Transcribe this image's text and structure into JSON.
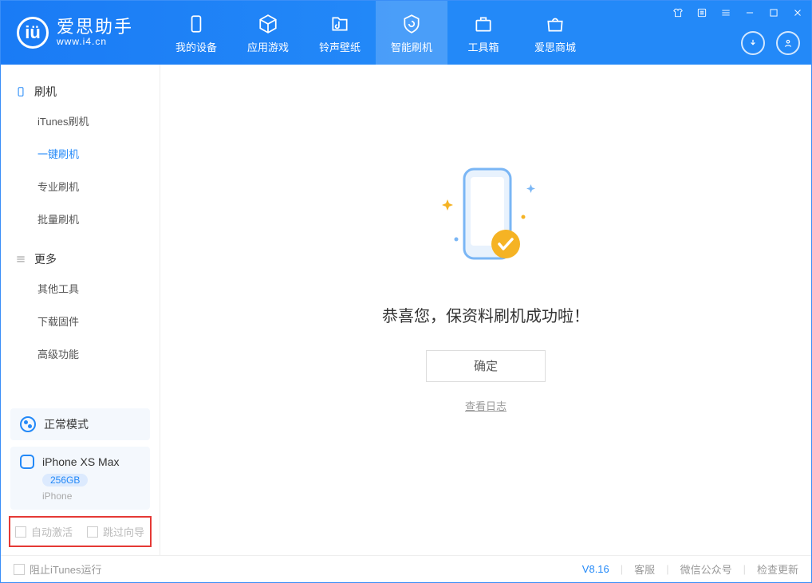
{
  "app": {
    "name": "爱思助手",
    "url": "www.i4.cn"
  },
  "tabs": [
    {
      "label": "我的设备"
    },
    {
      "label": "应用游戏"
    },
    {
      "label": "铃声壁纸"
    },
    {
      "label": "智能刷机"
    },
    {
      "label": "工具箱"
    },
    {
      "label": "爱思商城"
    }
  ],
  "sidebar": {
    "section1": {
      "title": "刷机",
      "items": [
        "iTunes刷机",
        "一键刷机",
        "专业刷机",
        "批量刷机"
      ]
    },
    "section2": {
      "title": "更多",
      "items": [
        "其他工具",
        "下载固件",
        "高级功能"
      ]
    }
  },
  "mode": {
    "label": "正常模式"
  },
  "device": {
    "name": "iPhone XS Max",
    "capacity": "256GB",
    "type": "iPhone"
  },
  "bottom_checks": {
    "auto_activate": "自动激活",
    "skip_guide": "跳过向导"
  },
  "content": {
    "success_msg": "恭喜您，保资料刷机成功啦！",
    "ok_btn": "确定",
    "view_log": "查看日志"
  },
  "footer": {
    "block_itunes": "阻止iTunes运行",
    "version": "V8.16",
    "customer_service": "客服",
    "wechat": "微信公众号",
    "check_update": "检查更新"
  }
}
